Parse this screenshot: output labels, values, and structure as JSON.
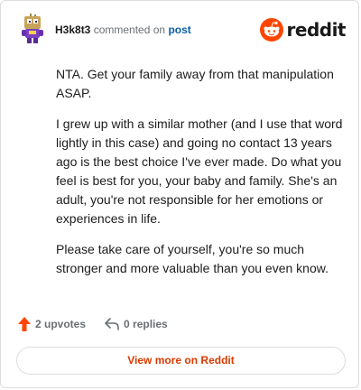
{
  "header": {
    "username": "H3k8t3",
    "action_text": "commented on",
    "post_link": "post",
    "brand": "reddit"
  },
  "comment": {
    "paragraphs": [
      "NTA. Get your family away from that manipulation ASAP.",
      "I grew up with a similar mother (and I use that word lightly in this case) and going no contact 13 years ago is the best choice I've ever made. Do what you feel is best for you, your baby and family. She's an adult, you're not responsible for her emotions or experiences in life.",
      "Please take care of yourself, you're so much stronger and more valuable than you even know."
    ]
  },
  "actions": {
    "upvotes": "2 upvotes",
    "replies": "0 replies"
  },
  "footer": {
    "view_more": "View more on Reddit"
  },
  "colors": {
    "brand_orange": "#ff4500",
    "link_blue": "#0a5ea8",
    "cta_orange": "#d93a00"
  },
  "icons": {
    "avatar": "snoo-avatar-icon",
    "brand": "reddit-logo-icon",
    "upvote": "upvote-arrow-icon",
    "reply": "reply-arrow-icon"
  }
}
